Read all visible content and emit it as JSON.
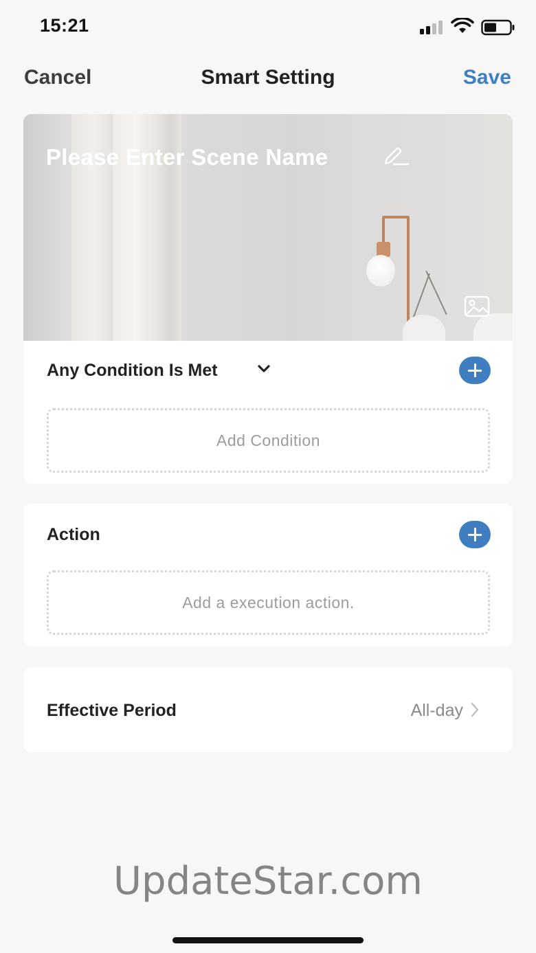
{
  "status_bar": {
    "time": "15:21",
    "icons": [
      "signal-icon",
      "wifi-icon",
      "battery-icon"
    ]
  },
  "nav": {
    "cancel_label": "Cancel",
    "title": "Smart Setting",
    "save_label": "Save",
    "accent_color": "#3f7ec0"
  },
  "banner": {
    "scene_name_placeholder": "Please Enter Scene Name",
    "edit_icon": "pencil-icon",
    "image_icon": "image-icon"
  },
  "conditions": {
    "title": "Any Condition Is Met",
    "dropdown_icon": "chevron-down-icon",
    "add_icon": "plus-icon",
    "placeholder": "Add Condition"
  },
  "actions": {
    "title": "Action",
    "add_icon": "plus-icon",
    "placeholder": "Add a execution action."
  },
  "effective_period": {
    "label": "Effective Period",
    "value": "All-day",
    "icon": "chevron-right-icon"
  },
  "watermark": "UpdateStar.com"
}
